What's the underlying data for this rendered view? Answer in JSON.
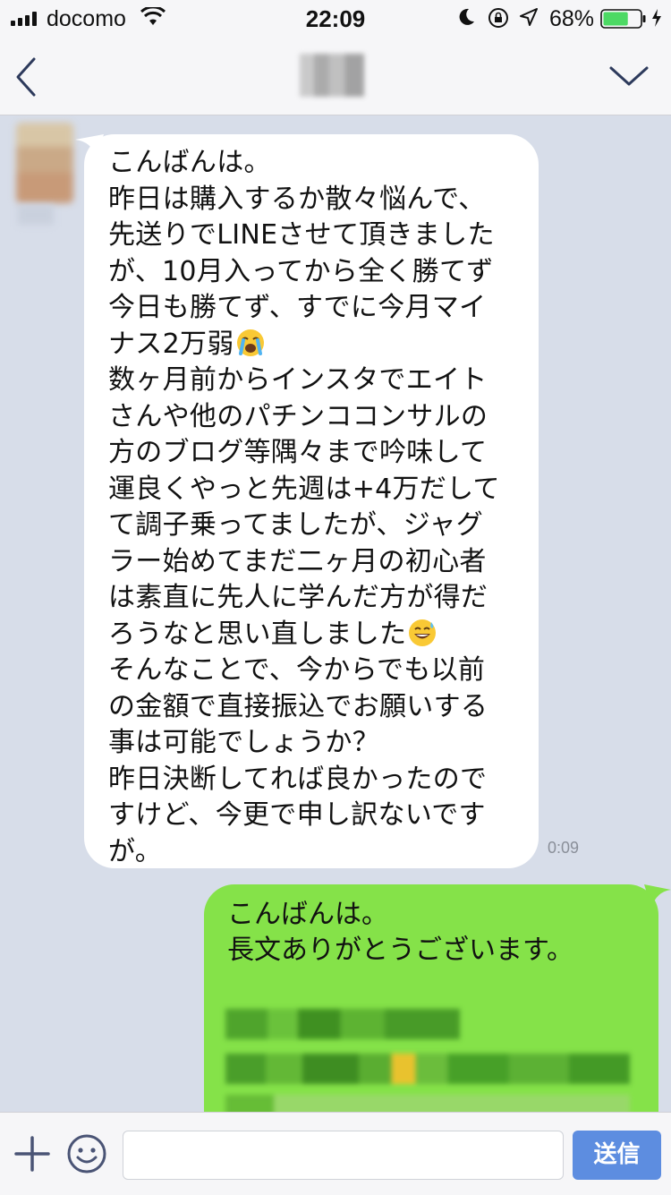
{
  "status_bar": {
    "carrier": "docomo",
    "time": "22:09",
    "battery_percent": "68%",
    "battery_level": 0.68
  },
  "nav": {
    "back_icon": "chevron-left-icon",
    "menu_icon": "chevron-down-icon"
  },
  "messages": [
    {
      "direction": "incoming",
      "segments": [
        {
          "text": "こんばんは。\n昨日は購入するか散々悩んで、\n先送りでLINEさせて頂きました\nが、10月入ってから全く勝てず\n今日も勝てず、すでに今月マイ\nナス2万弱"
        },
        {
          "emoji": "loudly-crying-face-icon"
        },
        {
          "text": "\n数ヶ月前からインスタでエイト\nさんや他のパチンココンサルの\n方のブログ等隅々まで吟味して\n運良くやっと先週は+4万だして\nて調子乗ってましたが、ジャグ\nラー始めてまだ二ヶ月の初心者\nは素直に先人に学んだ方が得だ\nろうなと思い直しました"
        },
        {
          "emoji": "grinning-face-with-sweat-icon"
        },
        {
          "text": "\nそんなことで、今からでも以前\nの金額で直接振込でお願いする\n事は可能でしょうか？\n昨日決断してれば良かったので\nすけど、今更で申し訳ないです\nが。"
        }
      ],
      "time": "0:09"
    },
    {
      "direction": "outgoing",
      "text": "こんばんは。\n長文ありがとうございます。"
    }
  ],
  "input_bar": {
    "plus_icon": "plus-icon",
    "emoji_icon": "smiley-icon",
    "placeholder": "",
    "send_label": "送信"
  },
  "colors": {
    "chat_background": "#d7dde9",
    "incoming_bubble": "#ffffff",
    "outgoing_bubble": "#85e249",
    "send_button": "#5d8de0"
  }
}
